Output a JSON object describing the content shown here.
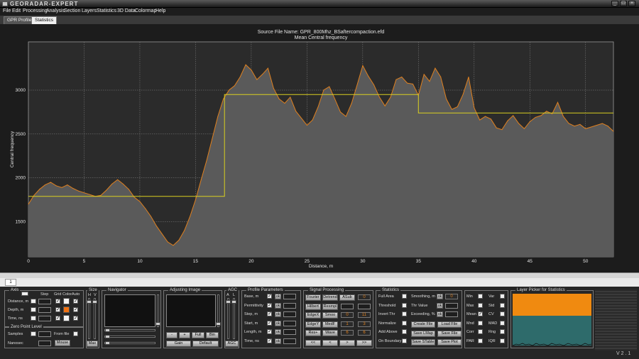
{
  "window": {
    "title": "GEORADAR-EXPERT",
    "version": "V 2 . 1"
  },
  "menu": [
    "File",
    "Edit",
    "Processing",
    "Analysis",
    "Section",
    "Layers",
    "Statistics",
    "3D Data",
    "Colormap",
    "Help"
  ],
  "tabs": [
    "GPR Profile",
    "Statistics"
  ],
  "page_tab": "1",
  "chart_data": {
    "type": "line",
    "title": "Source File Name: GPR_800Mhz_BSaftercompaction.efd",
    "subtitle": "Mean Central frequency",
    "xlabel": "Distance, m",
    "ylabel": "Central frequency",
    "xlim": [
      0,
      52.5
    ],
    "ylim": [
      1100,
      3550
    ],
    "xticks": [
      0,
      5,
      10,
      15,
      20,
      25,
      30,
      35,
      40,
      45,
      50
    ],
    "yticks": [
      1500,
      2000,
      2500,
      3000
    ],
    "grid": true,
    "series": [
      {
        "color": "#e0801e",
        "style": "line-with-fill",
        "x": [
          0,
          0.5,
          1,
          1.5,
          2,
          2.5,
          3,
          3.5,
          4,
          4.5,
          5,
          5.5,
          6,
          6.5,
          7,
          7.5,
          8,
          8.5,
          9,
          9.5,
          10,
          10.5,
          11,
          11.5,
          12,
          12.5,
          13,
          13.5,
          14,
          14.5,
          15,
          15.5,
          16,
          16.5,
          17,
          17.5,
          18,
          18.5,
          19,
          19.5,
          20,
          20.5,
          21,
          21.5,
          22,
          22.5,
          23,
          23.5,
          24,
          24.5,
          25,
          25.5,
          26,
          26.5,
          27,
          27.5,
          28,
          28.5,
          29,
          29.5,
          30,
          30.5,
          31,
          31.5,
          32,
          32.5,
          33,
          33.5,
          34,
          34.5,
          35,
          35.5,
          36,
          36.5,
          37,
          37.5,
          38,
          38.5,
          39,
          39.5,
          40,
          40.5,
          41,
          41.5,
          42,
          42.5,
          43,
          43.5,
          44,
          44.5,
          45,
          45.5,
          46,
          46.5,
          47,
          47.5,
          48,
          48.5,
          49,
          49.5,
          50,
          50.5,
          51,
          51.5,
          52,
          52.5
        ],
        "y": [
          1700,
          1800,
          1870,
          1920,
          1950,
          1910,
          1890,
          1920,
          1880,
          1850,
          1830,
          1810,
          1790,
          1800,
          1860,
          1930,
          1980,
          1930,
          1870,
          1780,
          1730,
          1650,
          1560,
          1450,
          1360,
          1270,
          1230,
          1290,
          1400,
          1560,
          1750,
          1980,
          2200,
          2450,
          2700,
          2900,
          3000,
          3050,
          3150,
          3290,
          3230,
          3120,
          3180,
          3250,
          3020,
          2900,
          2850,
          2920,
          2760,
          2680,
          2600,
          2660,
          2810,
          3000,
          3040,
          2900,
          2750,
          2700,
          2850,
          3060,
          3280,
          3160,
          3060,
          2920,
          2820,
          2920,
          3120,
          3150,
          3080,
          3070,
          2940,
          3180,
          3100,
          3250,
          3150,
          2900,
          2780,
          2810,
          2950,
          3150,
          2800,
          2660,
          2700,
          2670,
          2570,
          2550,
          2650,
          2710,
          2620,
          2560,
          2640,
          2690,
          2710,
          2760,
          2730,
          2860,
          2700,
          2620,
          2590,
          2610,
          2560,
          2580,
          2600,
          2620,
          2590,
          2530
        ]
      },
      {
        "color": "#d9d020",
        "style": "step",
        "x": [
          0,
          17.6,
          17.6,
          35,
          35,
          52.5
        ],
        "y": [
          1790,
          1790,
          2950,
          2950,
          2740,
          2740
        ]
      }
    ]
  },
  "axis_group": {
    "title": "Axis",
    "rows": [
      "Distance, m",
      "Depth, m",
      "Time, ns"
    ],
    "cols": [
      "Step",
      "Grid",
      "Color",
      "Auto"
    ]
  },
  "zero_point": {
    "title": "Zero Point Level",
    "samples": "Samples",
    "nanosec": "Nanosec",
    "from_file": "From file",
    "mouse": "Mouse"
  },
  "size_group": {
    "title": "Size",
    "h": "H",
    "v": "V",
    "max": "Max"
  },
  "navigator": {
    "title": "Navigator"
  },
  "adjusting": {
    "title": "Adjusting Image",
    "minus": "-",
    "plus": "+",
    "full": "Full",
    "bin": "Bin",
    "gain": "Gain",
    "default": "Default"
  },
  "agc": {
    "title": "AGC",
    "a": "A",
    "l": "L",
    "btn": "AGC"
  },
  "profile_params": {
    "title": "Profile Parameters",
    "ok": "ok",
    "rows": [
      "Base, m",
      "Permittivity",
      "Step, m",
      "Start, m",
      "Length, m",
      "Time, ns"
    ]
  },
  "signal_processing": {
    "title": "Signal Processing",
    "rows": [
      [
        "Fourier",
        "Detrend",
        "ASub",
        "0"
      ],
      [
        "Hilbert",
        "Resmpl",
        "",
        ""
      ],
      [
        "EdgeX",
        "Smoo",
        "0",
        "11"
      ],
      [
        "EdgeY",
        "MedF",
        "1",
        "3"
      ],
      [
        "Res+",
        "Wave",
        "6",
        "6"
      ]
    ],
    "nav": [
      "<<",
      "<",
      ">",
      ">>"
    ]
  },
  "statistics": {
    "title": "Statistics",
    "left": [
      "Full Area",
      "Threshold",
      "Invert Thr",
      "Normalize",
      "Add Above",
      "On Boundary"
    ],
    "mid": [
      "Smoothing, m",
      "Thr Value",
      "Exceeding, %"
    ],
    "smoothing_value": "0",
    "ok": "ok",
    "buttons": [
      "Create File",
      "Load File",
      "Save LMap",
      "Save File",
      "Save STable",
      "Save Plot"
    ],
    "metrics1": [
      "Min",
      "Max",
      "Mean",
      "Mnd",
      "Corr",
      "PAR"
    ],
    "metrics2": [
      "Var",
      "Std",
      "CV",
      "MAD",
      "Rng",
      "IQR"
    ]
  },
  "layer_picker": {
    "title": "Layer Picker for Statistics",
    "top_color": "#f08a10",
    "bottom_color": "#2e6b6b"
  },
  "colors": {
    "plot_bg": "#2b2b2b",
    "fill": "#5a5a5a",
    "line": "#e0801e",
    "step": "#d9d020"
  }
}
